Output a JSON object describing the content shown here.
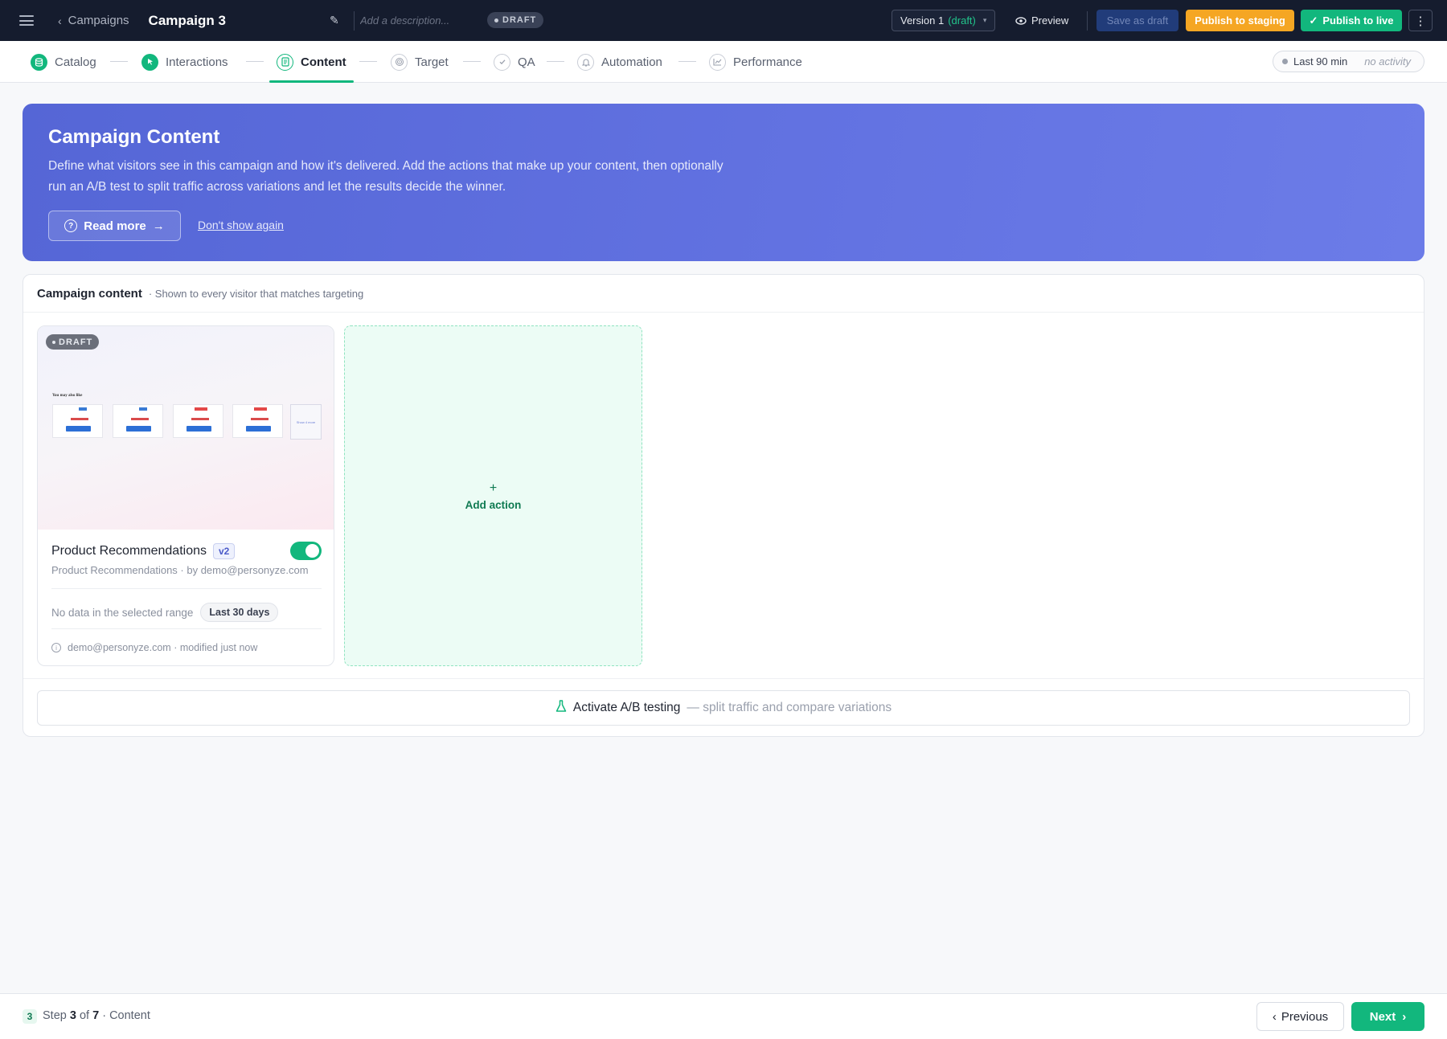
{
  "topbar": {
    "back_label": "Campaigns",
    "campaign_title": "Campaign 3",
    "description_placeholder": "Add a description...",
    "status_badge": "DRAFT",
    "version_label": "Version 1",
    "version_state": "(draft)",
    "preview_label": "Preview",
    "save_draft_label": "Save as draft",
    "publish_staging_label": "Publish to staging",
    "publish_live_label": "Publish to live"
  },
  "steps": [
    {
      "label": "Catalog",
      "state": "done"
    },
    {
      "label": "Interactions",
      "state": "done"
    },
    {
      "label": "Content",
      "state": "active"
    },
    {
      "label": "Target",
      "state": "todo"
    },
    {
      "label": "QA",
      "state": "todo"
    },
    {
      "label": "Automation",
      "state": "todo"
    },
    {
      "label": "Performance",
      "state": "todo"
    }
  ],
  "activity": {
    "range": "Last 90 min",
    "status": "no activity"
  },
  "hero": {
    "title": "Campaign Content",
    "description": "Define what visitors see in this campaign and how it's delivered. Add the actions that make up your content, then optionally run an A/B test to split traffic across variations and let the results decide the winner.",
    "read_more_label": "Read more",
    "dont_show_label": "Don't show again"
  },
  "content_panel": {
    "title": "Campaign content",
    "subtitle": "· Shown to every visitor that matches targeting",
    "action_card": {
      "badge": "DRAFT",
      "preview_heading": "You may also like",
      "preview_more": "Show 4 more",
      "name": "Product Recommendations",
      "version": "v2",
      "enabled": true,
      "subtitle": "Product Recommendations · by demo@personyze.com",
      "no_data_text": "No data in the selected range",
      "range_pill": "Last 30 days",
      "meta": "demo@personyze.com · modified just now"
    },
    "add_action_label": "Add action",
    "ab_test": {
      "label": "Activate A/B testing",
      "hint": "— split traffic and compare variations"
    }
  },
  "footer": {
    "current_step": "3",
    "step_word": "Step",
    "of_word": "of",
    "total_steps": "7",
    "step_name": "· Content",
    "previous_label": "Previous",
    "next_label": "Next"
  },
  "colors": {
    "topbar_bg": "#151c2e",
    "accent_green": "#12b77d",
    "staging_orange": "#f5a623",
    "hero_indigo": "#5a6bdc"
  }
}
